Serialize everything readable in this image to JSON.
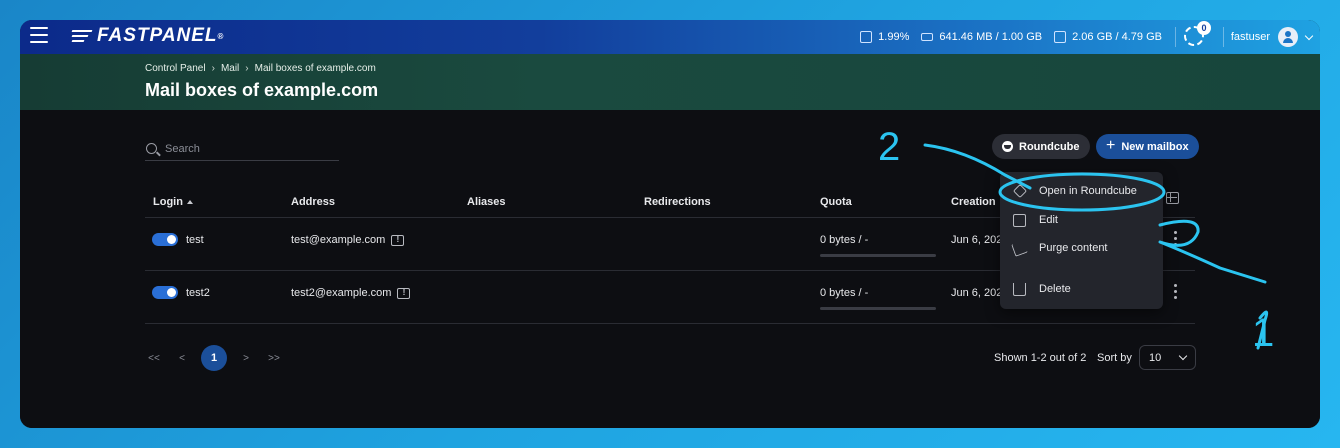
{
  "topbar": {
    "logo_text": "FASTPANEL",
    "logo_reg": "®",
    "cpu": "1.99%",
    "ram": "641.46 MB / 1.00 GB",
    "disk": "2.06 GB / 4.79 GB",
    "notifications_count": "0",
    "username": "fastuser"
  },
  "breadcrumb": {
    "items": [
      "Control Panel",
      "Mail",
      "Mail boxes of example.com"
    ]
  },
  "page_title": "Mail boxes of example.com",
  "toolbar": {
    "search_placeholder": "Search",
    "roundcube_label": "Roundcube",
    "new_mailbox_label": "New mailbox",
    "new_mailbox_plus": "+"
  },
  "table": {
    "headers": [
      "Login",
      "Address",
      "Aliases",
      "Redirections",
      "Quota",
      "Creation"
    ],
    "rows": [
      {
        "login": "test",
        "address": "test@example.com",
        "quota": "0 bytes / -",
        "created": "Jun 6, 202"
      },
      {
        "login": "test2",
        "address": "test2@example.com",
        "quota": "0 bytes / -",
        "created": "Jun 6, 202"
      }
    ]
  },
  "context_menu": {
    "items": [
      "Open in Roundcube",
      "Edit",
      "Purge content",
      "Delete"
    ]
  },
  "pagination": {
    "first": "<<",
    "prev": "<",
    "current": "1",
    "next": ">",
    "last": ">>",
    "shown": "Shown 1-2 out of 2",
    "sort_by_label": "Sort by",
    "page_size": "10"
  },
  "annotations": {
    "label_1": "1",
    "label_2": "2",
    "color": "#2bc4f0"
  }
}
